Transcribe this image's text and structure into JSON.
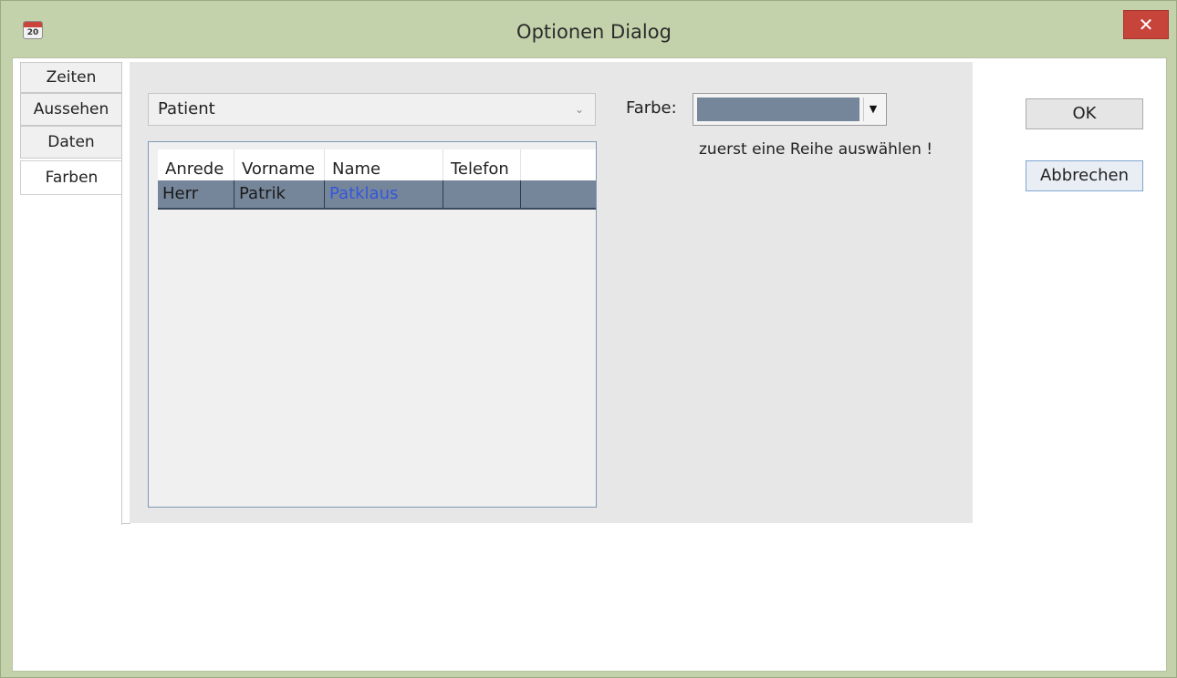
{
  "window": {
    "title": "Optionen Dialog",
    "icon": "calendar-icon",
    "icon_text": "20",
    "close_glyph": "✕"
  },
  "tabs": [
    {
      "label": "Zeiten",
      "selected": false
    },
    {
      "label": "Aussehen",
      "selected": false
    },
    {
      "label": "Daten",
      "selected": false
    },
    {
      "label": "Farben",
      "selected": true
    }
  ],
  "farben": {
    "category_select": {
      "value": "Patient",
      "chevron": "⌄"
    },
    "grid": {
      "columns": [
        "Anrede",
        "Vorname",
        "Name",
        "Telefon"
      ],
      "rows": [
        {
          "anrede": "Herr",
          "vorname": "Patrik",
          "name": "Patklaus",
          "telefon": ""
        }
      ]
    },
    "farbe_label": "Farbe:",
    "farbe_arrow": "▼",
    "hint": "zuerst eine Reihe auswählen !"
  },
  "buttons": {
    "ok": "OK",
    "cancel": "Abbrechen"
  },
  "colors": {
    "title_bar": "#c4d2ac",
    "close_button": "#c7443a",
    "selected_row": "#76869a",
    "link_text": "#3355dd",
    "farbe_swatch": "#76869a"
  }
}
